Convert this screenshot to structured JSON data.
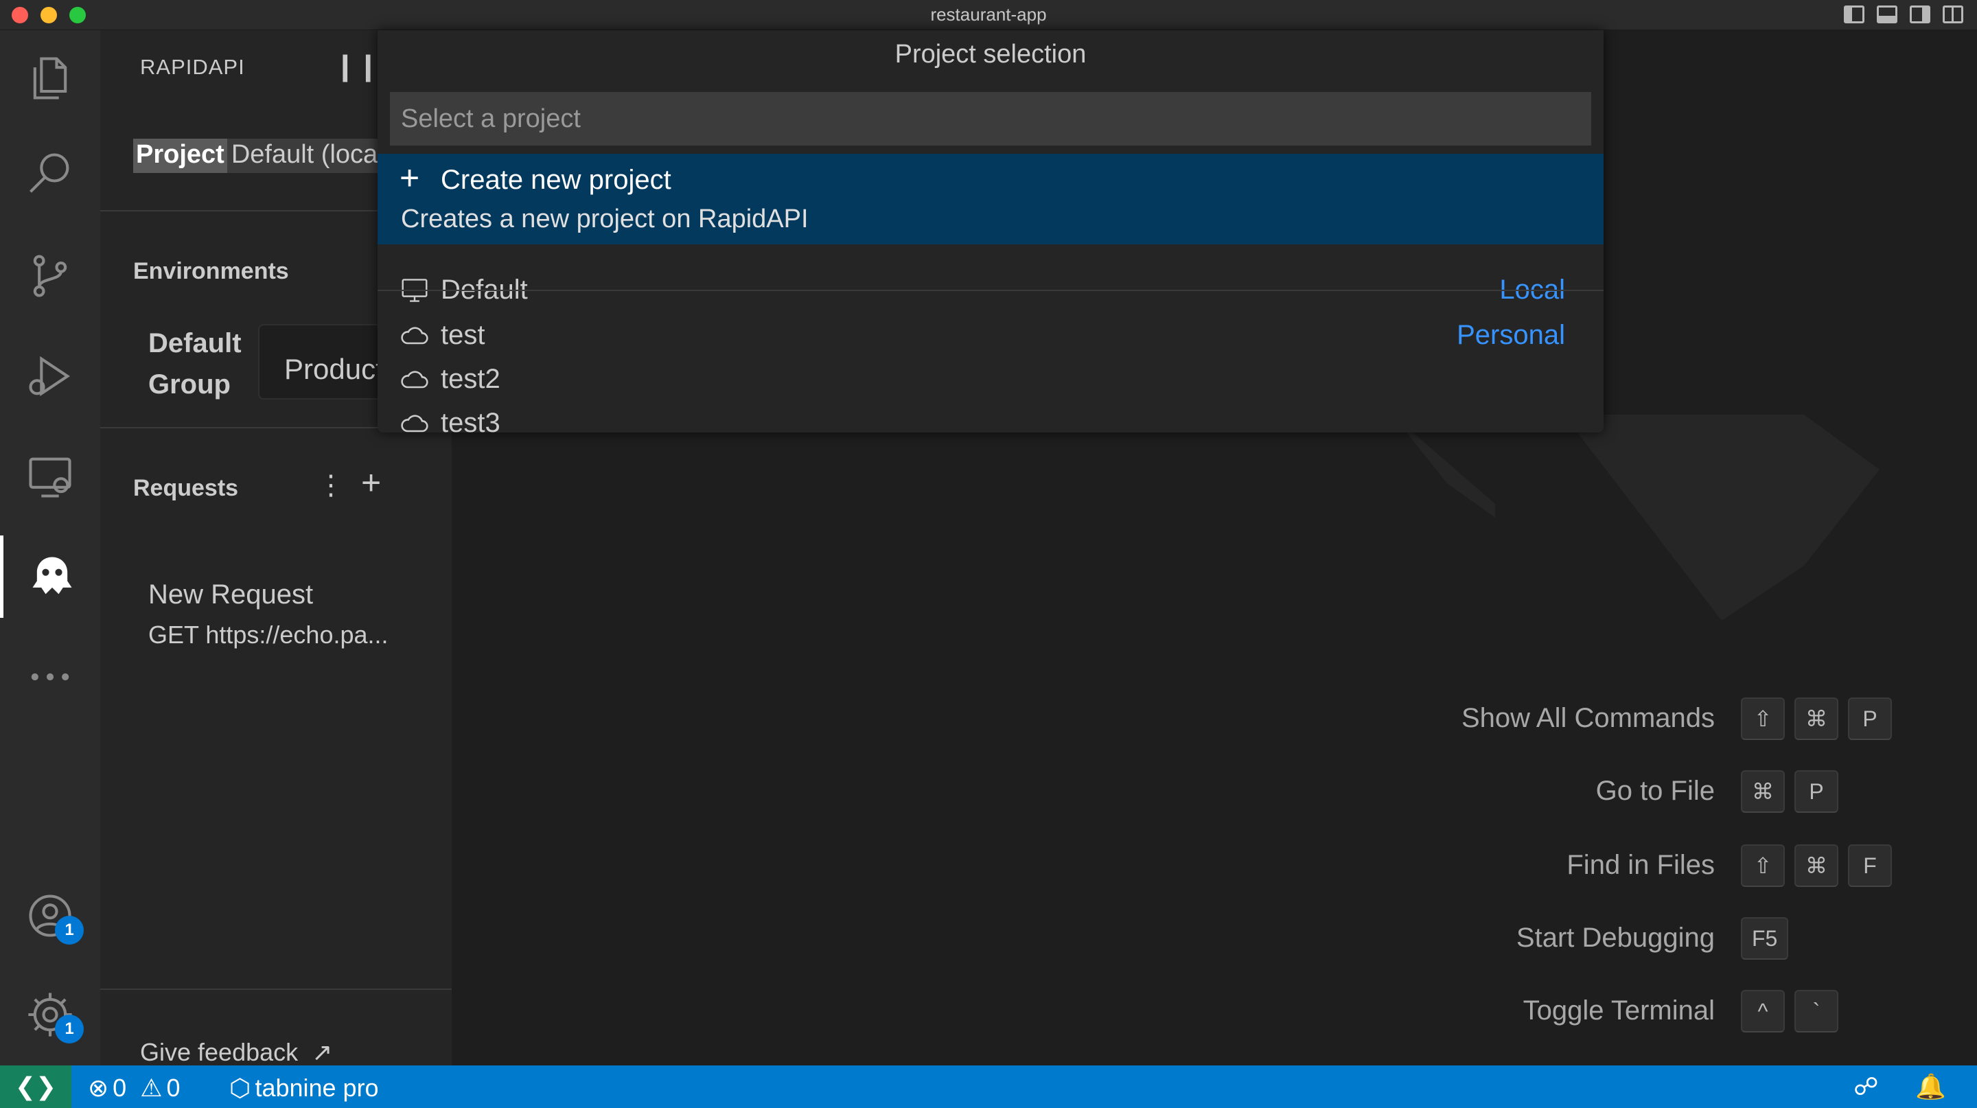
{
  "window": {
    "title": "restaurant-app"
  },
  "activity_bar": {
    "items": [
      "explorer-icon",
      "search-icon",
      "source-control-icon",
      "run-debug-icon",
      "remote-explorer-icon",
      "rapidapi-icon",
      "more-icon"
    ],
    "accounts_badge": "1",
    "settings_badge": "1"
  },
  "sidebar": {
    "title": "RAPIDAPI",
    "project_label": "Project",
    "project_value": "Default (local)",
    "environments_title": "Environments",
    "env_group": "Default\nGroup",
    "env_value": "Production",
    "requests_title": "Requests",
    "request": {
      "name": "New Request",
      "url": "GET https://echo.pa..."
    },
    "feedback": "Give feedback"
  },
  "quick_pick": {
    "title": "Project selection",
    "placeholder": "Select a project",
    "selected": {
      "label": "Create new project",
      "description": "Creates a new project on RapidAPI"
    },
    "items": [
      {
        "label": "Default",
        "tag": "Local",
        "icon": "monitor-icon"
      },
      {
        "label": "test",
        "tag": "Personal",
        "icon": "cloud-icon"
      },
      {
        "label": "test2",
        "tag": "",
        "icon": "cloud-icon"
      },
      {
        "label": "test3",
        "tag": "",
        "icon": "cloud-icon"
      }
    ]
  },
  "shortcuts": [
    {
      "label": "Show All Commands",
      "keys": [
        "⇧",
        "⌘",
        "P"
      ]
    },
    {
      "label": "Go to File",
      "keys": [
        "⌘",
        "P"
      ]
    },
    {
      "label": "Find in Files",
      "keys": [
        "⇧",
        "⌘",
        "F"
      ]
    },
    {
      "label": "Start Debugging",
      "keys": [
        "F5"
      ]
    },
    {
      "label": "Toggle Terminal",
      "keys": [
        "^",
        "`"
      ]
    }
  ],
  "status_bar": {
    "errors": "0",
    "warnings": "0",
    "tabnine": "tabnine pro"
  },
  "colors": {
    "accent": "#007acc",
    "selection": "#04395e",
    "link": "#3794ff"
  }
}
